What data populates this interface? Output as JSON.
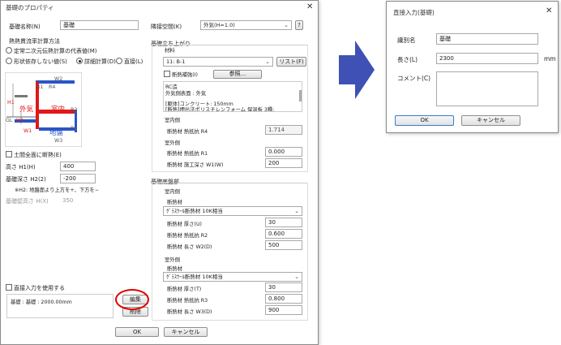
{
  "main": {
    "title": "基礎のプロパティ",
    "name_label": "基礎名称(N)",
    "name_value": "基礎",
    "calc_group_title": "熱熱貫流率計算方法",
    "calc_opt1": "定常二次元伝熱計算の代表値(M)",
    "calc_opt2": "形状依存しない値(S)",
    "calc_opt3": "詳細計算(D)",
    "calc_opt4": "直接(L)",
    "diagram": {
      "w2": "W2",
      "r1": "R1",
      "r4": "R4",
      "h1": "H1",
      "outside": "外気",
      "inside": "室内",
      "r2": "R2",
      "gl": "GL",
      "h2": "H2",
      "w1": "W1",
      "ground": "地盤",
      "r3": "R3",
      "w3": "W3"
    },
    "dirt_floor_check": "土間全面に断熱(E)",
    "height_label": "高さ H1(H)",
    "height_value": "400",
    "depth_label": "基礎深さ H2(2)",
    "depth_value": "-200",
    "depth_note": "※H2: 地盤面より上方を+、下方を−",
    "base_wall_label": "基礎壁高さ H(X)",
    "base_wall_value": "350",
    "direct_check": "直接入力を使用する",
    "direct_value": "基礎 : 基礎 : 2000.00mm",
    "edit_button": "編集",
    "delete_button": "削除",
    "ok_button": "OK",
    "cancel_button": "キャンセル",
    "adj_space_label": "隣接空間(K)",
    "adj_space_value": "外気(H=1.0)",
    "help_button": "?",
    "rise_title": "基礎立ち上がり",
    "material_label": "材料",
    "material_value": "11: B-1",
    "list_button": "リスト(F)",
    "ins_rep_check": "断熱補強(I)",
    "ref_button": "参照...",
    "info_lines": [
      "RC造",
      "外気側表面 : 外気",
      "",
      "[躯体]コンクリート: 150mm",
      "[断熱]押出法ポリスチレンフォーム 保温板 3種:"
    ],
    "in_side1": "室内側",
    "in_r4_label": "断熱材 熱抵抗 R4",
    "in_r4_value": "1.714",
    "out_side1": "室外側",
    "out_r1_label": "断熱材 熱抵抗 R1",
    "out_r1_value": "0.000",
    "out_w1_label": "断熱材 施工深さ W1(W)",
    "out_w1_value": "200",
    "base_bottom_title": "基礎底盤部",
    "in_side2": "室内側",
    "in_mat_label": "断熱材",
    "in_mat_value": "ｸﾞﾗｽｳｰﾙ断熱材 10K相当",
    "in_thick_label": "断熱材 厚さ(U)",
    "in_thick_value": "30",
    "in_r2_label": "断熱材 熱抵抗 R2",
    "in_r2_value": "0.600",
    "in_len_label": "断熱材 長さ W2(D)",
    "in_len_value": "500",
    "out_side2": "室外側",
    "out_mat_label": "断熱材",
    "out_mat_value": "ｸﾞﾗｽｳｰﾙ断熱材 10K相当",
    "out_thick_label": "断熱材 厚さ(T)",
    "out_thick_value": "30",
    "out_r3_label": "断熱材 熱抵抗 R3",
    "out_r3_value": "0.800",
    "out_len_label": "断熱材 長さ W3(D)",
    "out_len_value": "900"
  },
  "direct": {
    "title": "直接入力(基礎)",
    "id_label": "識別名",
    "id_value": "基礎",
    "len_label": "長さ(L)",
    "len_value": "2300",
    "len_unit": "mm",
    "comment_label": "コメント(C)",
    "ok_button": "OK",
    "cancel_button": "キャンセル"
  },
  "colors": {
    "arrow": "#3f51b5",
    "highlight_circle": "#e00000",
    "wall_red": "#e01818",
    "insulation_blue": "#2a55c8"
  }
}
